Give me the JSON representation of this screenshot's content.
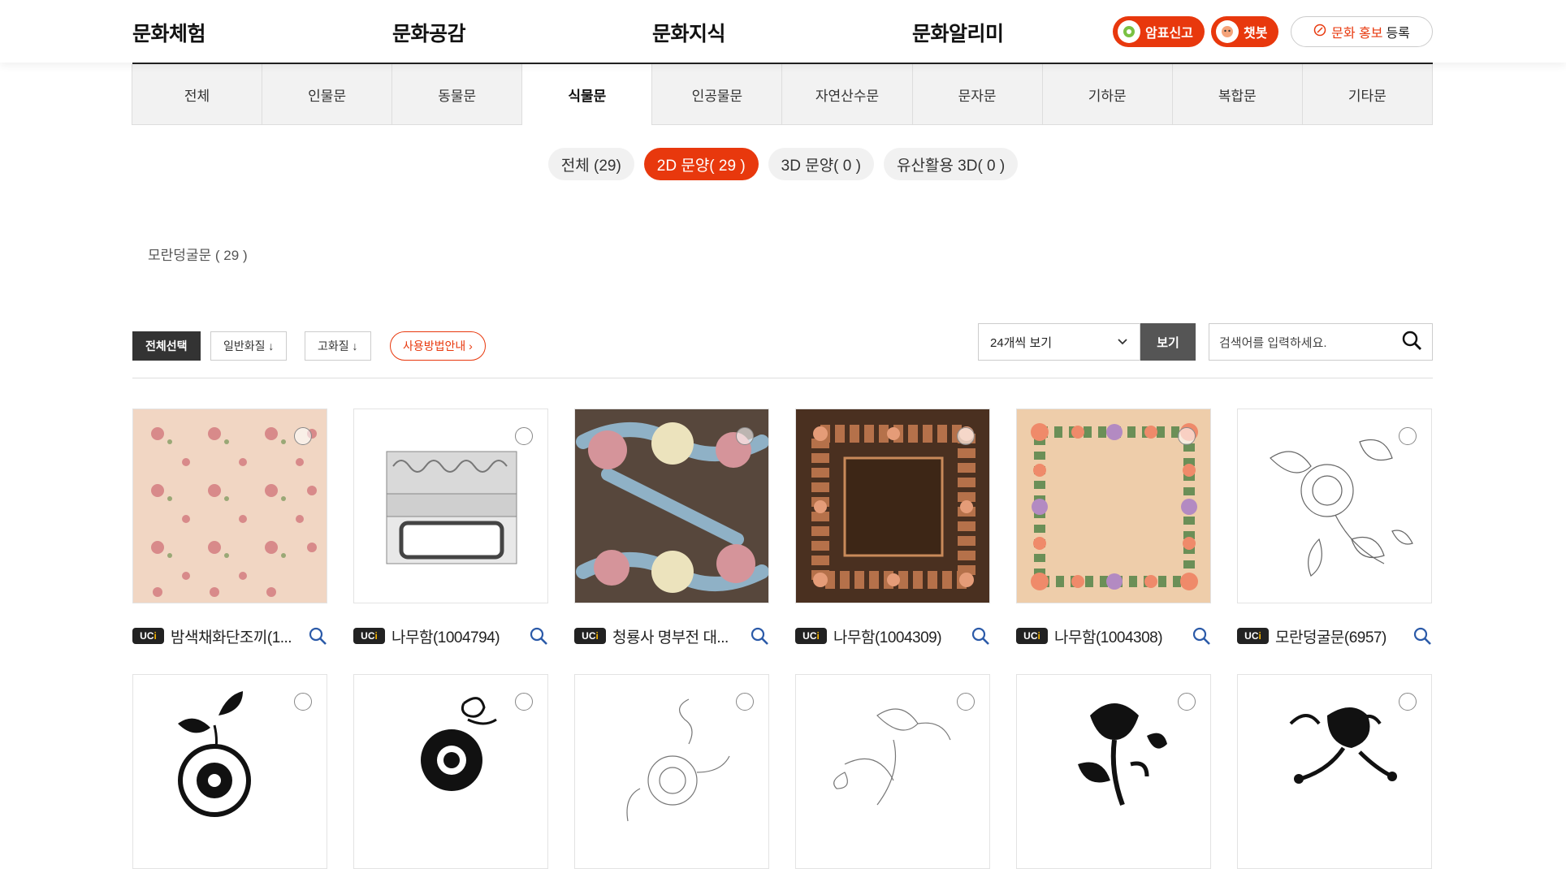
{
  "gnb": [
    "문화체험",
    "문화공감",
    "문화지식",
    "문화알리미"
  ],
  "top_buttons": {
    "report": "암표신고",
    "chatbot": "챗봇",
    "promo_accent": "문화 홍보",
    "promo_rest": "등록"
  },
  "tabs": [
    "전체",
    "인물문",
    "동물문",
    "식물문",
    "인공물문",
    "자연산수문",
    "문자문",
    "기하문",
    "복합문",
    "기타문"
  ],
  "active_tab": "식물문",
  "pills": [
    {
      "label": "전체 (29)",
      "active": false
    },
    {
      "label": "2D 문양( 29 )",
      "active": true
    },
    {
      "label": "3D 문양( 0 )",
      "active": false
    },
    {
      "label": "유산활용 3D( 0 )",
      "active": false
    }
  ],
  "subcategory": "모란덩굴문 ( 29 )",
  "toolbar": {
    "select_all": "전체선택",
    "normal_quality": "일반화질 ↓",
    "high_quality": "고화질 ↓",
    "usage_guide": "사용방법안내 ›",
    "per_page": "24개씩 보기",
    "view": "보기",
    "search_placeholder": "검색어를 입력하세요."
  },
  "badge": {
    "uc": "UC",
    "dot": "i"
  },
  "items": [
    {
      "title": "밤색채화단조끼(1...",
      "thumb": "pink-pattern"
    },
    {
      "title": "나무함(1004794)",
      "thumb": "wooden-box"
    },
    {
      "title": "청룡사 명부전 대...",
      "thumb": "peony-brown"
    },
    {
      "title": "나무함(1004309)",
      "thumb": "frame-dark"
    },
    {
      "title": "나무함(1004308)",
      "thumb": "frame-beige"
    },
    {
      "title": "모란덩굴문(6957)",
      "thumb": "line-peony"
    },
    {
      "title": "",
      "thumb": "black-flower-1"
    },
    {
      "title": "",
      "thumb": "black-flower-2"
    },
    {
      "title": "",
      "thumb": "line-flower-2"
    },
    {
      "title": "",
      "thumb": "line-flower-3"
    },
    {
      "title": "",
      "thumb": "black-flower-3"
    },
    {
      "title": "",
      "thumb": "black-flower-4"
    }
  ],
  "colors": {
    "accent": "#e8380d",
    "dark": "#333333"
  }
}
